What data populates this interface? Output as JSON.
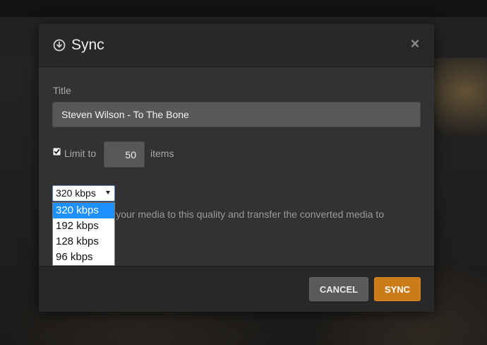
{
  "dialog": {
    "title": "Sync",
    "title_field_label": "Title",
    "title_value": "Steven Wilson - To The Bone",
    "limit": {
      "checked": true,
      "label": "Limit to",
      "value": "50",
      "suffix": "items"
    },
    "quality": {
      "selected": "320 kbps",
      "options": [
        "320 kbps",
        "192 kbps",
        "128 kbps",
        "96 kbps"
      ]
    },
    "help_text": "ert your media to this quality and transfer the converted media to",
    "buttons": {
      "cancel": "CANCEL",
      "sync": "SYNC"
    }
  },
  "colors": {
    "accent": "#cc7b19",
    "selection": "#1e90ff"
  },
  "icons": {
    "header": "sync-download-icon",
    "close": "close-icon",
    "select_arrow": "chevron-down-icon"
  }
}
